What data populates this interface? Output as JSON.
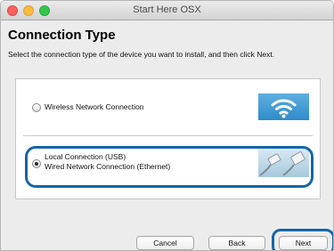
{
  "window": {
    "title": "Start Here OSX"
  },
  "page": {
    "heading": "Connection Type",
    "instructions": "Select the connection type of the device you want to install, and then click Next."
  },
  "options": [
    {
      "label": "Wireless Network Connection",
      "selected": false,
      "icon": "wifi-icon"
    },
    {
      "label_line1": "Local Connection (USB)",
      "label_line2": "Wired Network Connection (Ethernet)",
      "selected": true,
      "icon": "usb-ethernet-cable-icon"
    }
  ],
  "buttons": {
    "cancel": "Cancel",
    "back": "Back",
    "next": "Next"
  },
  "colors": {
    "highlight": "#1566a8",
    "wifi_bg": "#2f8bc9"
  }
}
